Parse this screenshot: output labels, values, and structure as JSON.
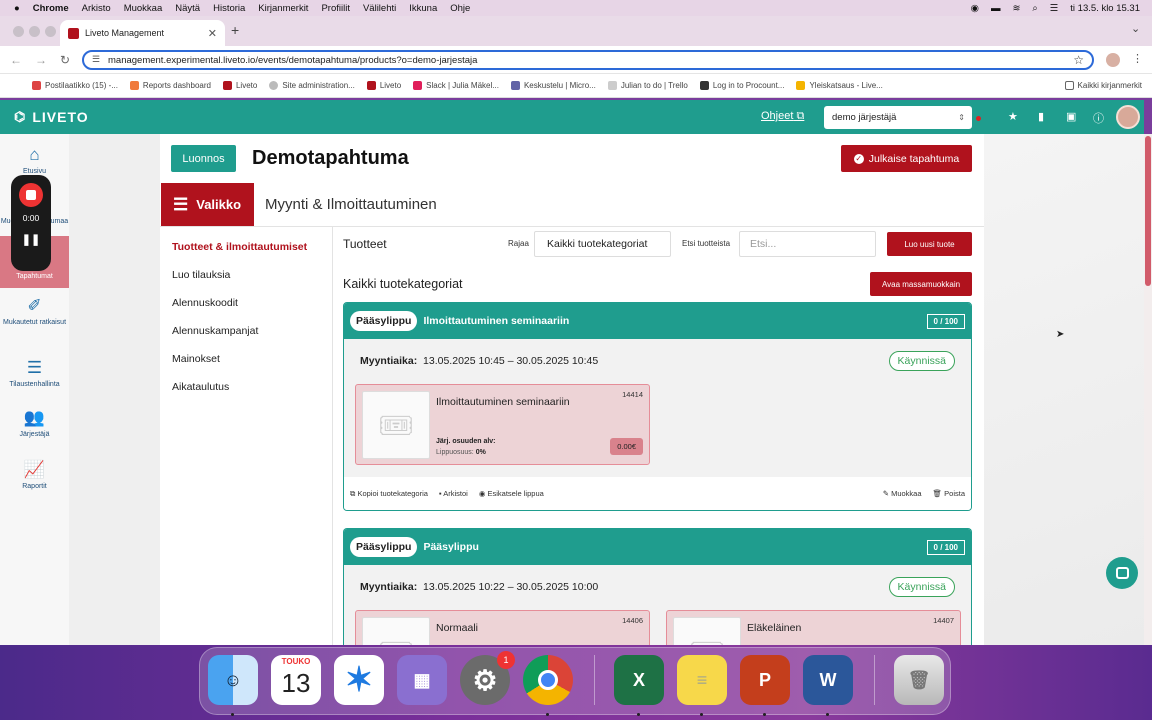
{
  "menubar": {
    "items": [
      "Chrome",
      "Arkisto",
      "Muokkaa",
      "Näytä",
      "Historia",
      "Kirjanmerkit",
      "Profiilit",
      "Välilehti",
      "Ikkuna",
      "Ohje"
    ],
    "datetime": "ti 13.5. klo 15.31"
  },
  "browser": {
    "tab_title": "Liveto Management",
    "url": "management.experimental.liveto.io/events/demotapahtuma/products?o=demo-jarjestaja",
    "bookmarks": [
      "Postilaatikko (15) -...",
      "Reports dashboard",
      "Liveto",
      "Site administration...",
      "Liveto",
      "Slack | Julia Mäkel...",
      "Keskustelu | Micro...",
      "Julian to do | Trello",
      "Log in to Procount...",
      "Yleiskatsaus - Live..."
    ],
    "bookmarks_all": "Kaikki kirjanmerkit"
  },
  "app": {
    "logo": "LIVETO",
    "help": "Ohjeet",
    "org_select": "demo järjestäjä"
  },
  "sidebar": {
    "items": [
      {
        "label": "Etusivu"
      },
      {
        "label": "Muokkaa tapahtumaa"
      },
      {
        "label": "Tapahtumat"
      },
      {
        "label": "Mukautetut ratkaisut"
      },
      {
        "label": "Tilaustenhallinta"
      },
      {
        "label": "Järjestäjä"
      },
      {
        "label": "Raportit"
      }
    ]
  },
  "recorder": {
    "time": "0:00"
  },
  "event": {
    "status_badge": "Luonnos",
    "title": "Demotapahtuma",
    "publish_button": "Julkaise tapahtuma",
    "menu_button": "Valikko",
    "section_title": "Myynti & Ilmoittautuminen"
  },
  "leftnav": [
    "Tuotteet & ilmoittautumiset",
    "Luo tilauksia",
    "Alennuskoodit",
    "Alennuskampanjat",
    "Mainokset",
    "Aikataulutus"
  ],
  "products": {
    "heading": "Tuotteet",
    "filter_label": "Rajaa",
    "category_select": "Kaikki tuotekategoriat",
    "search_label": "Etsi tuotteista",
    "search_placeholder": "Etsi...",
    "new_product_button": "Luo uusi tuote",
    "category_heading": "Kaikki tuotekategoriat",
    "mass_edit_button": "Avaa massamuokkain"
  },
  "cards": [
    {
      "type": "Pääsylippu",
      "name": "Ilmoittautuminen seminaariin",
      "capacity": "0 / 100",
      "sale_label": "Myyntiaika:",
      "sale_time": "13.05.2025 10:45 – 30.05.2025 10:45",
      "status": "Käynnissä",
      "tickets": [
        {
          "name": "Ilmoittautuminen seminaariin",
          "id": "14414",
          "vat": "Järj. osuuden alv:",
          "fee_label": "Lippuosuus:",
          "fee": "0%",
          "price": "0.00€"
        }
      ],
      "footer": {
        "copy": "Kopioi tuotekategoria",
        "archive": "Arkistoi",
        "preview": "Esikatsele lippua",
        "edit": "Muokkaa",
        "delete": "Poista"
      }
    },
    {
      "type": "Pääsylippu",
      "name": "Pääsylippu",
      "capacity": "0 / 100",
      "sale_label": "Myyntiaika:",
      "sale_time": "13.05.2025 10:22 – 30.05.2025 10:00",
      "status": "Käynnissä",
      "tickets": [
        {
          "name": "Normaali",
          "id": "14406"
        },
        {
          "name": "Eläkeläinen",
          "id": "14407"
        }
      ]
    }
  ],
  "dock": {
    "calendar_month": "TOUKO",
    "calendar_day": "13",
    "settings_badge": "1"
  },
  "colors": {
    "teal": "#1f9d8e",
    "brand_red": "#b0121d",
    "running_green": "#3aa35a"
  }
}
